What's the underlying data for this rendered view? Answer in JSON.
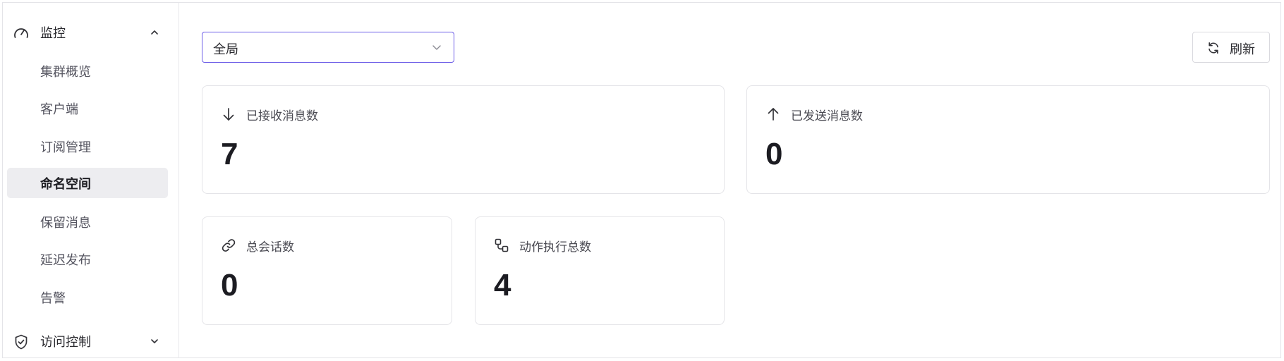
{
  "sidebar": {
    "monitor_group": {
      "label": "监控",
      "icon": "gauge-icon",
      "expanded": true
    },
    "items": [
      {
        "label": "集群概览"
      },
      {
        "label": "客户端"
      },
      {
        "label": "订阅管理"
      },
      {
        "label": "命名空间",
        "active": true
      },
      {
        "label": "保留消息"
      },
      {
        "label": "延迟发布"
      },
      {
        "label": "告警"
      }
    ],
    "access_group": {
      "label": "访问控制",
      "icon": "shield-check-icon",
      "expanded": false
    }
  },
  "toolbar": {
    "scope_select": {
      "value": "全局"
    },
    "refresh_label": "刷新"
  },
  "stats": {
    "received": {
      "title": "已接收消息数",
      "value": "7",
      "icon": "arrow-down-icon"
    },
    "sent": {
      "title": "已发送消息数",
      "value": "0",
      "icon": "arrow-up-icon"
    },
    "sessions": {
      "title": "总会话数",
      "value": "0",
      "icon": "link-icon"
    },
    "actions": {
      "title": "动作执行总数",
      "value": "4",
      "icon": "workflow-icon"
    }
  },
  "colors": {
    "accent": "#6c5ce7",
    "active_bg": "#ededf0",
    "border": "#e4e4e8"
  }
}
